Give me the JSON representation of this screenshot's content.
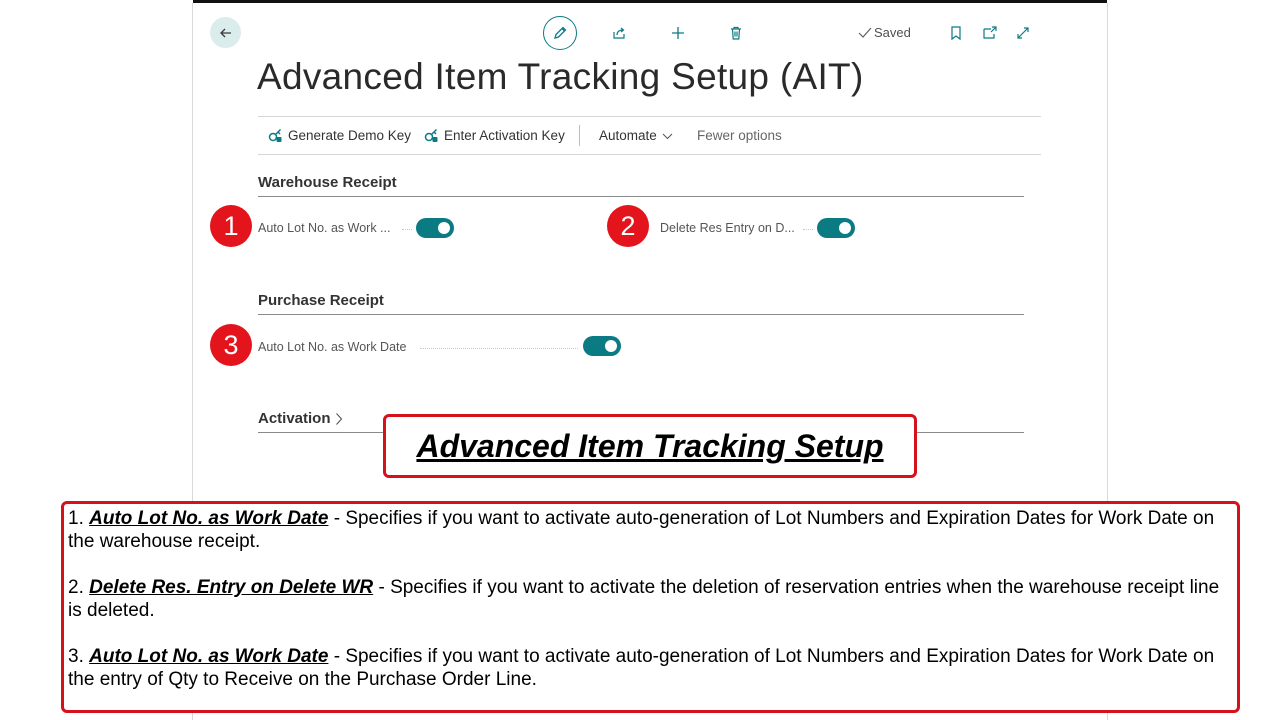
{
  "page": {
    "title": "Advanced Item Tracking Setup (AIT)",
    "saved_status": "Saved"
  },
  "toolbar": {
    "icons": [
      "back-arrow-icon",
      "pencil-icon",
      "share-icon",
      "plus-icon",
      "trash-icon",
      "bookmark-icon",
      "open-new-window-icon",
      "expand-icon"
    ]
  },
  "actions": {
    "generate_demo_key": "Generate Demo Key",
    "enter_activation_key": "Enter Activation Key",
    "automate": "Automate",
    "fewer_options": "Fewer options"
  },
  "sections": {
    "warehouse_receipt": {
      "title": "Warehouse Receipt",
      "fields": [
        {
          "label": "Auto Lot No. as Work ...",
          "value": true
        },
        {
          "label": "Delete Res Entry on D...",
          "value": true
        }
      ]
    },
    "purchase_receipt": {
      "title": "Purchase Receipt",
      "fields": [
        {
          "label": "Auto Lot No. as Work Date",
          "value": true
        }
      ]
    },
    "activation": {
      "title": "Activation"
    }
  },
  "annotations": {
    "badges": [
      "1",
      "2",
      "3"
    ],
    "callout_title": "Advanced Item Tracking Setup",
    "descriptions": [
      {
        "number": "1.",
        "name": "Auto Lot No. as Work Date",
        "text": "Specifies if you want to activate auto-generation of Lot Numbers and Expiration Dates for Work Date on the warehouse receipt."
      },
      {
        "number": "2.",
        "name": "Delete Res. Entry on Delete WR",
        "text": "Specifies if you want to activate the deletion of reservation entries when the warehouse receipt line is deleted."
      },
      {
        "number": "3.",
        "name": "Auto Lot No. as Work Date",
        "text": "Specifies if you want to activate auto-generation of Lot Numbers and Expiration Dates for Work Date on the entry of Qty to Receive on the Purchase Order Line."
      }
    ]
  },
  "colors": {
    "accent": "#0b7b83",
    "annotation_red": "#e4141c"
  }
}
